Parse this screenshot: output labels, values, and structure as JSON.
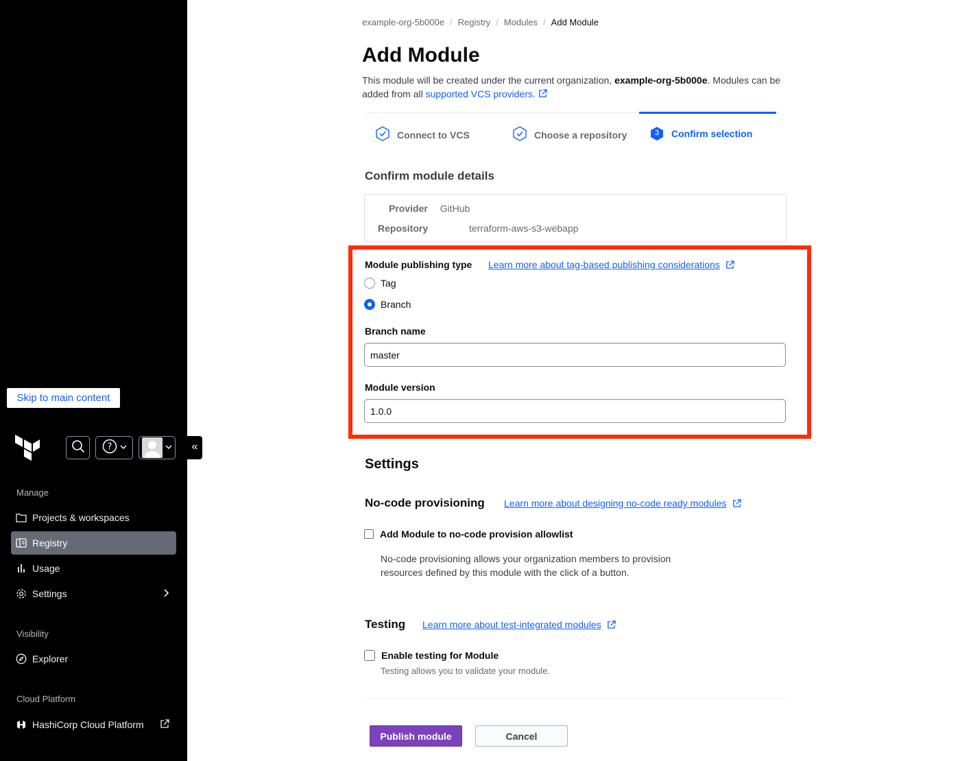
{
  "sidebar": {
    "skip_link": "Skip to main content",
    "sections": [
      {
        "heading": "Manage"
      },
      {
        "heading": "Visibility"
      },
      {
        "heading": "Cloud Platform"
      }
    ],
    "items": [
      {
        "label": "Projects & workspaces",
        "icon": "folder-icon"
      },
      {
        "label": "Registry",
        "icon": "registry-icon",
        "active": true
      },
      {
        "label": "Usage",
        "icon": "bar-chart-icon"
      },
      {
        "label": "Settings",
        "icon": "gear-icon"
      },
      {
        "label": "Explorer",
        "icon": "compass-icon"
      },
      {
        "label": "HashiCorp Cloud Platform",
        "icon": "hashicorp-icon"
      }
    ],
    "collapse_glyph": "«"
  },
  "breadcrumb": {
    "items": [
      "example-org-5b000e",
      "Registry",
      "Modules",
      "Add Module"
    ],
    "separator": "/"
  },
  "page": {
    "title": "Add Module",
    "intro_prefix": "This module will be created under the current organization, ",
    "org_name": "example-org-5b000e",
    "intro_suffix": ". Modules can be added from all ",
    "intro_link": "supported VCS providers."
  },
  "steps": [
    {
      "label": "Connect to VCS",
      "state": "complete"
    },
    {
      "label": "Choose a repository",
      "state": "complete"
    },
    {
      "label": "Confirm selection",
      "state": "current",
      "number": "3"
    }
  ],
  "details": {
    "heading": "Confirm module details",
    "provider_label": "Provider",
    "provider_value": "GitHub",
    "repository_label": "Repository",
    "repository_value": "terraform-aws-s3-webapp"
  },
  "publishing": {
    "label": "Module publishing type",
    "learn_link": "Learn more about tag-based publishing considerations",
    "options": [
      {
        "label": "Tag",
        "checked": false
      },
      {
        "label": "Branch",
        "checked": true
      }
    ],
    "branch_label": "Branch name",
    "branch_value": "master",
    "version_label": "Module version",
    "version_value": "1.0.0"
  },
  "settings": {
    "heading": "Settings",
    "nocode": {
      "heading": "No-code provisioning",
      "learn_link": "Learn more about designing no-code ready modules",
      "checkbox_label": "Add Module to no-code provision allowlist",
      "help_line1": "No-code provisioning allows your organization members to provision",
      "help_line2": "resources defined by this module with the click of a button."
    },
    "testing": {
      "heading": "Testing",
      "learn_link": "Learn more about test-integrated modules",
      "checkbox_label": "Enable testing for Module",
      "help": "Testing allows you to validate your module."
    }
  },
  "actions": {
    "publish": "Publish module",
    "cancel": "Cancel"
  },
  "colors": {
    "accent": "#1060ff",
    "primary_button": "#7b42bc",
    "highlight": "#ff2d09",
    "sidebar_bg": "#000000"
  }
}
